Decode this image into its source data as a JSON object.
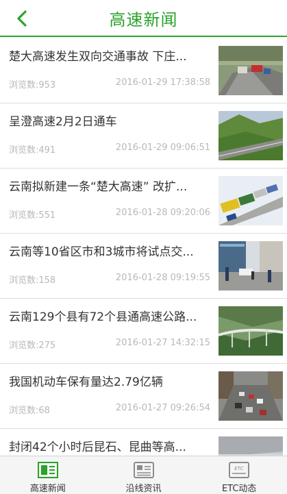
{
  "header": {
    "title": "高速新闻"
  },
  "news": [
    {
      "title": "楚大高速发生双向交通事故 下庄...",
      "views": "浏览数:953",
      "date": "2016-01-29 17:38:58",
      "image": "accident-highway-photo"
    },
    {
      "title": "呈澄高速2月2日通车",
      "views": "浏览数:491",
      "date": "2016-01-29 09:06:51",
      "image": "mountain-highway-photo"
    },
    {
      "title": "云南拟新建一条“楚大高速” 改扩...",
      "views": "浏览数:551",
      "date": "2016-01-28 09:20:06",
      "image": "traffic-jam-trucks-photo"
    },
    {
      "title": "云南等10省区市和3城市将试点交...",
      "views": "浏览数:158",
      "date": "2016-01-28 09:19:55",
      "image": "police-street-photo"
    },
    {
      "title": "云南129个县有72个县通高速公路...",
      "views": "浏览数:275",
      "date": "2016-01-27 14:32:15",
      "image": "viaduct-valley-photo"
    },
    {
      "title": "我国机动车保有量达2.79亿辆",
      "views": "浏览数:68",
      "date": "2016-01-27 09:26:54",
      "image": "city-traffic-photo"
    },
    {
      "title": "封闭42个小时后昆石、昆曲等高...",
      "views": "",
      "date": "",
      "image": "snow-road-photo"
    }
  ],
  "tabs": [
    {
      "label": "高速新闻",
      "icon": "news-icon",
      "active": true
    },
    {
      "label": "沿线资讯",
      "icon": "info-icon",
      "active": false
    },
    {
      "label": "ETC动态",
      "icon": "etc-card-icon",
      "active": false
    }
  ],
  "colors": {
    "accent": "#2aa32a",
    "muted": "#b8b8b8"
  }
}
